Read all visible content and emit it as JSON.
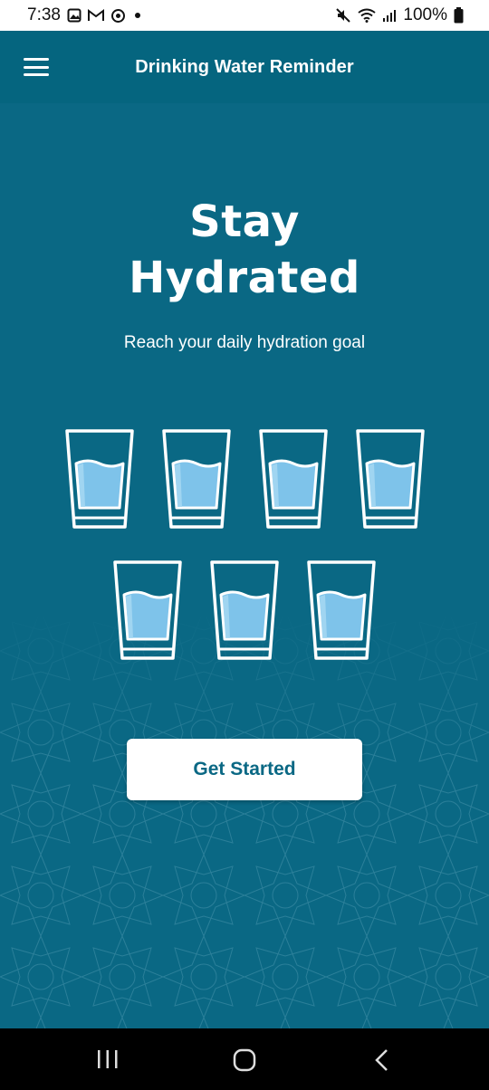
{
  "status_bar": {
    "time": "7:38",
    "battery": "100%",
    "icons_left": [
      "gallery-icon",
      "gmail-icon",
      "sync-icon",
      "dot-icon"
    ],
    "icons_right": [
      "mute-icon",
      "wifi-icon",
      "signal-icon",
      "battery-icon"
    ]
  },
  "app_bar": {
    "title": "Drinking Water Reminder",
    "menu_icon": "hamburger-menu-icon"
  },
  "hero": {
    "title_line1": "Stay",
    "title_line2": "Hydrated",
    "subtitle": "Reach your daily hydration goal"
  },
  "glasses": {
    "count": 7,
    "icon": "water-glass-icon",
    "water_color": "#7ec3ea"
  },
  "cta": {
    "label": "Get Started"
  },
  "nav_bar": {
    "items": [
      "recents-icon",
      "home-icon",
      "back-icon"
    ]
  },
  "colors": {
    "primary": "#0a6884",
    "app_bar": "#05657f",
    "white": "#ffffff"
  }
}
